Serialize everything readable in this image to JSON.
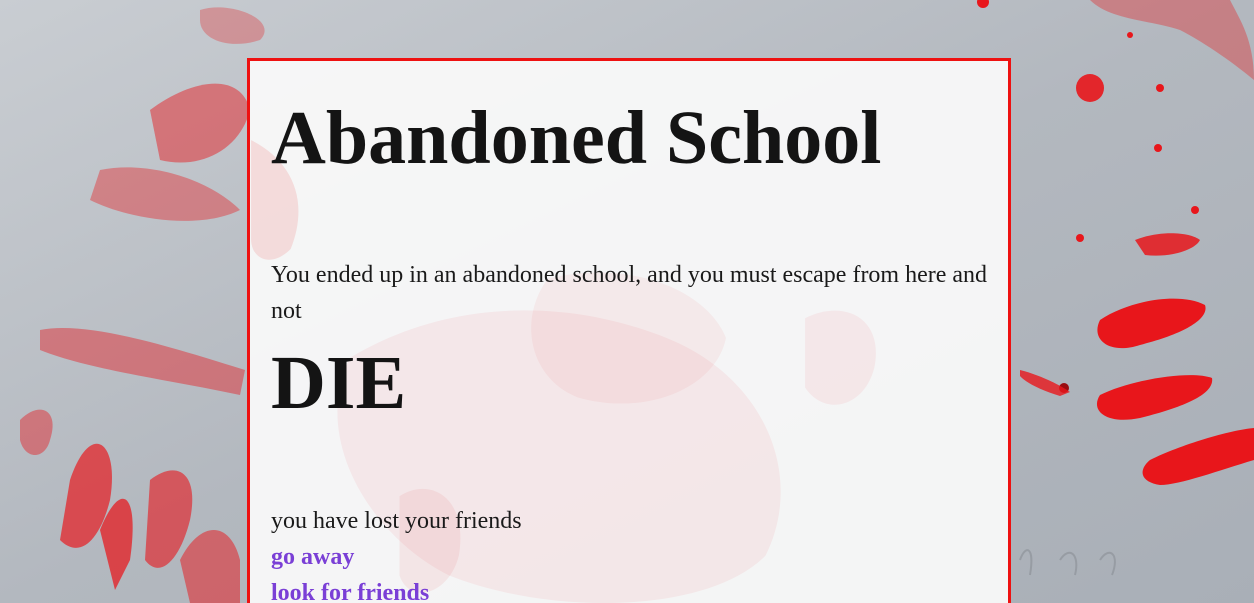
{
  "story": {
    "title": "Abandoned School",
    "intro": "You ended up in an abandoned school, and you must escape from here and not",
    "emphasis": "DIE",
    "status": "you have lost your friends",
    "choices": [
      {
        "label": "go away"
      },
      {
        "label": "look for friends"
      }
    ]
  },
  "colors": {
    "panel_border": "#ee1111",
    "link": "#7a3fd6",
    "text": "#141414",
    "blood": "#e8161b"
  }
}
